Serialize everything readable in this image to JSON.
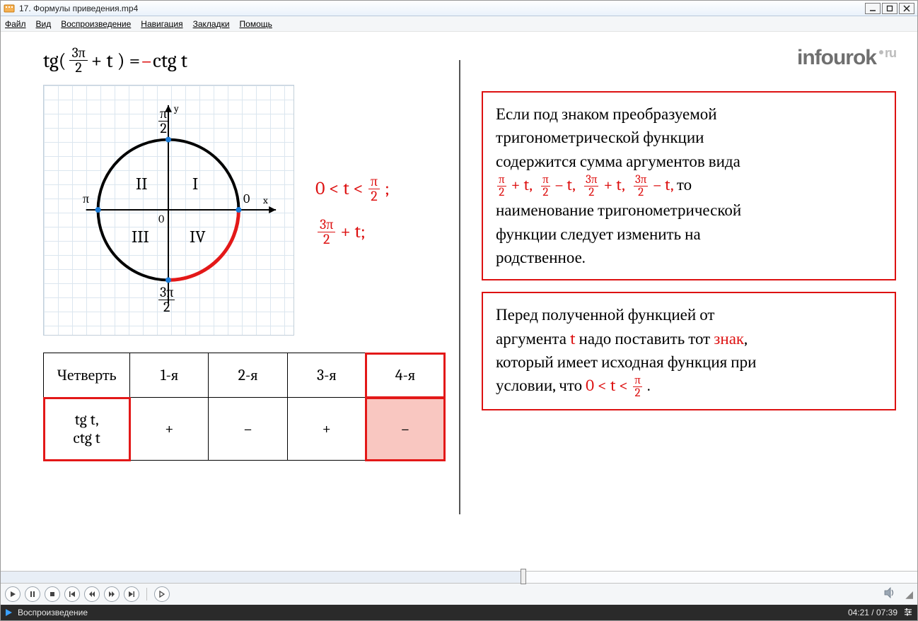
{
  "window": {
    "title": "17. Формулы приведения.mp4"
  },
  "menu": {
    "file": "Файл",
    "view": "Вид",
    "playback": "Воспроизведение",
    "navigation": "Навигация",
    "bookmarks": "Закладки",
    "help": "Помощь"
  },
  "formula": {
    "lhs_fn": "tg(",
    "frac_num": "3π",
    "frac_den": "2",
    "plus": " + t ) = ",
    "minus": "– ",
    "rhs": "ctg t"
  },
  "circle": {
    "labels": {
      "q1": "I",
      "q2": "II",
      "q3": "III",
      "q4": "IV"
    },
    "axes": {
      "top_num": "π",
      "top_den": "2",
      "left": "π",
      "right": "0",
      "bottom_num": "3π",
      "bottom_den": "2",
      "origin": "0",
      "x": "x",
      "y": "y"
    }
  },
  "sideeq": {
    "line1_pre": "0 < t < ",
    "line1_num": "π",
    "line1_den": "2",
    "line1_post": " ;",
    "line2_num": "3π",
    "line2_den": "2",
    "line2_post": " + t;"
  },
  "table": {
    "header": [
      "Четверть",
      "1-я",
      "2-я",
      "3-я",
      "4-я"
    ],
    "row_label_1": "tg t,",
    "row_label_2": "ctg t",
    "row": [
      "+",
      "–",
      "+",
      "–"
    ]
  },
  "logo": {
    "text": "infourok",
    "suffix": "ru"
  },
  "box1": {
    "l1": "Если под знаком преобразуемой",
    "l2": "тригонометрической функции",
    "l3": "содержится сумма аргументов вида",
    "terms": [
      {
        "num": "π",
        "den": "2",
        "op": "+ t,"
      },
      {
        "num": "π",
        "den": "2",
        "op": "– t,"
      },
      {
        "num": "3π",
        "den": "2",
        "op": "+ t,"
      },
      {
        "num": "3π",
        "den": "2",
        "op": "– t,"
      }
    ],
    "l4": "  то",
    "l5": "наименование тригонометрической",
    "l6": "функции следует изменить на",
    "l7": "родственное."
  },
  "box2": {
    "l1": "Перед полученной функцией от",
    "l2a": "аргумента ",
    "l2b": "t",
    "l2c": " надо поставить тот ",
    "l2d": "знак",
    "l2e": ",",
    "l3": "который имеет исходная функция при",
    "l4a": "условии, что ",
    "l4b": "0 < t < ",
    "l4num": "π",
    "l4den": "2",
    "l4c": " ."
  },
  "seek": {
    "progress_pct": 57
  },
  "status": {
    "label": "Воспроизведение",
    "time": "04:21 / 07:39"
  }
}
